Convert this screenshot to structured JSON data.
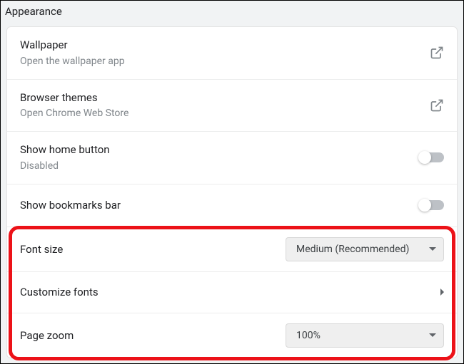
{
  "section": {
    "title": "Appearance"
  },
  "rows": {
    "wallpaper": {
      "title": "Wallpaper",
      "subtitle": "Open the wallpaper app"
    },
    "themes": {
      "title": "Browser themes",
      "subtitle": "Open Chrome Web Store"
    },
    "homeButton": {
      "title": "Show home button",
      "subtitle": "Disabled"
    },
    "bookmarksBar": {
      "title": "Show bookmarks bar"
    },
    "fontSize": {
      "title": "Font size",
      "value": "Medium (Recommended)"
    },
    "customizeFonts": {
      "title": "Customize fonts"
    },
    "pageZoom": {
      "title": "Page zoom",
      "value": "100%"
    }
  }
}
